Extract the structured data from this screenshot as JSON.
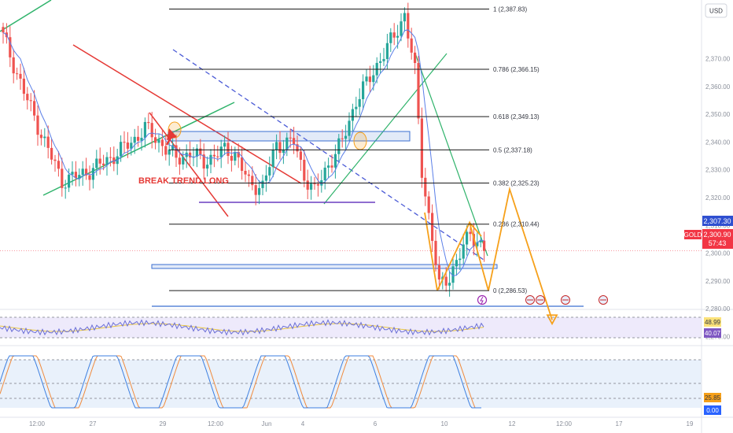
{
  "header": {
    "currency_label": "USD"
  },
  "colors": {
    "up": "#26a69a",
    "down": "#ef5350",
    "ma": "#5b7fe8",
    "fib_line": "#1b1b1b",
    "trend_red": "#e53935",
    "trend_green": "#2fb36b",
    "trend_dashed": "#4b5bd6",
    "projection": "#f6a01a",
    "support_box": "#3b6fd1",
    "rsi": "#6b6fd6",
    "rsi_ma": "#e8c542",
    "stoch_k": "#3d7fe0",
    "stoch_d": "#f08a3c",
    "price_tag": "#f23645",
    "price_tag_upper": "#2f4fd0"
  },
  "annotation": {
    "break_trend_label": "BREAK TREND LONG"
  },
  "symbol": {
    "name": "GOLD",
    "last_price": "2,300.90",
    "countdown": "57:43",
    "upper_tag_price": "2,307.30"
  },
  "fib_levels": [
    {
      "label": "1 (2,387.83)",
      "value": 2387.83
    },
    {
      "label": "0.786 (2,366.15)",
      "value": 2366.15
    },
    {
      "label": "0.618 (2,349.13)",
      "value": 2349.13
    },
    {
      "label": "0.5 (2,337.18)",
      "value": 2337.18
    },
    {
      "label": "0.382 (2,325.23)",
      "value": 2325.23
    },
    {
      "label": "0.236 (2,310.44)",
      "value": 2310.44
    },
    {
      "label": "0 (2,286.53)",
      "value": 2286.53
    }
  ],
  "chart_data": {
    "type": "candlestick",
    "symbol": "GOLD",
    "currency": "USD",
    "price_axis_ticks": [
      "2,370.00",
      "2,360.00",
      "2,350.00",
      "2,340.00",
      "2,330.00",
      "2,320.00",
      "2,310.00",
      "2,300.00",
      "2,290.00",
      "2,280.00",
      "2,270.00"
    ],
    "time_axis_ticks": [
      "12:00",
      "27",
      "29",
      "12:00",
      "Jun",
      "4",
      "6",
      "10",
      "12",
      "12:00",
      "17",
      "19"
    ],
    "ylim": [
      2268,
      2392
    ],
    "price_path": [
      {
        "t": 0,
        "p": 2378
      },
      {
        "t": 6,
        "p": 2358
      },
      {
        "t": 12,
        "p": 2340
      },
      {
        "t": 17,
        "p": 2326
      },
      {
        "t": 22,
        "p": 2328
      },
      {
        "t": 27,
        "p": 2331
      },
      {
        "t": 33,
        "p": 2336
      },
      {
        "t": 38,
        "p": 2341
      },
      {
        "t": 41,
        "p": 2345
      },
      {
        "t": 46,
        "p": 2339
      },
      {
        "t": 50,
        "p": 2334
      },
      {
        "t": 54,
        "p": 2336
      },
      {
        "t": 58,
        "p": 2333
      },
      {
        "t": 64,
        "p": 2337
      },
      {
        "t": 67,
        "p": 2336
      },
      {
        "t": 71,
        "p": 2325
      },
      {
        "t": 75,
        "p": 2324
      },
      {
        "t": 79,
        "p": 2339
      },
      {
        "t": 84,
        "p": 2340
      },
      {
        "t": 87,
        "p": 2328
      },
      {
        "t": 90,
        "p": 2322
      },
      {
        "t": 94,
        "p": 2332
      },
      {
        "t": 98,
        "p": 2340
      },
      {
        "t": 102,
        "p": 2355
      },
      {
        "t": 106,
        "p": 2363
      },
      {
        "t": 109,
        "p": 2370
      },
      {
        "t": 113,
        "p": 2378
      },
      {
        "t": 116,
        "p": 2386
      },
      {
        "t": 119,
        "p": 2365
      },
      {
        "t": 121,
        "p": 2330
      },
      {
        "t": 124,
        "p": 2305
      },
      {
        "t": 126,
        "p": 2288
      },
      {
        "t": 129,
        "p": 2292
      },
      {
        "t": 132,
        "p": 2299
      },
      {
        "t": 135,
        "p": 2308
      },
      {
        "t": 137,
        "p": 2304
      },
      {
        "t": 139,
        "p": 2301
      }
    ],
    "projection_path": [
      {
        "label": "low-1",
        "p": 2286.5
      },
      {
        "label": "swing-high",
        "p": 2311
      },
      {
        "label": "low-2",
        "p": 2286.5
      },
      {
        "label": "target-high",
        "p": 2323
      },
      {
        "label": "target-low",
        "p": 2276
      }
    ],
    "indicators": {
      "rsi": {
        "value_a": "48.99",
        "value_b": "40.07"
      },
      "stochastic": {
        "k": "25.85",
        "d": "0.00"
      }
    }
  }
}
